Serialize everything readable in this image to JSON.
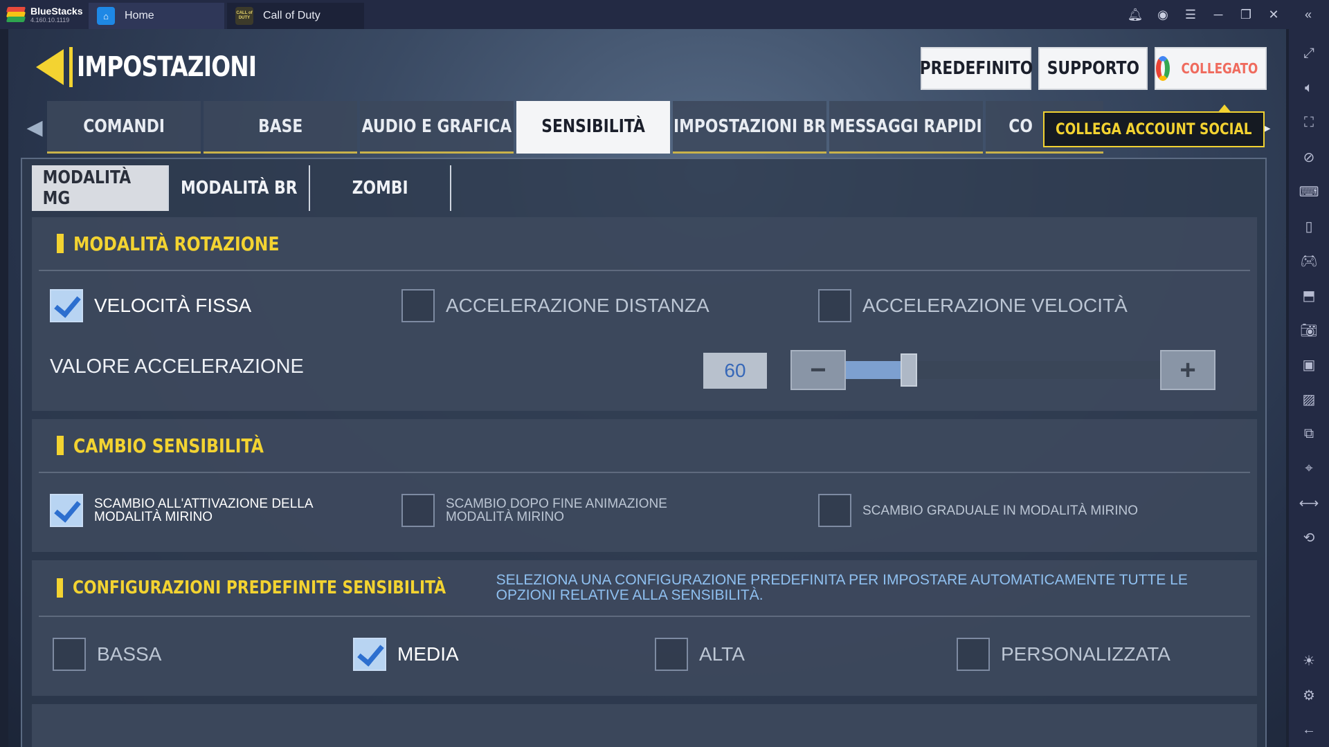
{
  "app": {
    "name": "BlueStacks",
    "version": "4.160.10.1119",
    "tabs": [
      {
        "label": "Home",
        "icon": "home-icon"
      },
      {
        "label": "Call of Duty",
        "icon": "call-of-duty-icon",
        "icon_text": "CALL of DUTY"
      }
    ],
    "window_controls": [
      "bell-icon",
      "account-icon",
      "menu-icon",
      "minimize-icon",
      "restore-icon",
      "close-icon",
      "collapse-sidebar-icon"
    ],
    "sidebar_icons": [
      "fullscreen-icon",
      "mute-icon",
      "screen-select-icon",
      "eye-off-icon",
      "keyboard-icon",
      "phone-icon",
      "gamepad-icon",
      "install-apk-icon",
      "camera-icon",
      "record-icon",
      "media-icon",
      "multi-instance-icon",
      "location-icon",
      "shake-icon",
      "rotate-icon",
      "brightness-icon",
      "settings-icon",
      "back-icon"
    ]
  },
  "game": {
    "title": "IMPOSTAZIONI",
    "top_buttons": {
      "default": "PREDEFINITO",
      "support": "SUPPORTO",
      "linked": "COLLEGATO"
    },
    "main_tabs": [
      "COMANDI",
      "BASE",
      "AUDIO E GRAFICA",
      "SENSIBILITÀ",
      "IMPOSTAZIONI BR",
      "MESSAGGI RAPIDI",
      "CO"
    ],
    "active_main_tab": "SENSIBILITÀ",
    "social_banner": "COLLEGA ACCOUNT SOCIAL",
    "sub_tabs": [
      "MODALITÀ MG",
      "MODALITÀ BR",
      "ZOMBI"
    ],
    "active_sub_tab": "MODALITÀ MG",
    "rotation": {
      "title": "MODALITÀ ROTAZIONE",
      "options": [
        {
          "label": "VELOCITÀ FISSA",
          "checked": true
        },
        {
          "label": "ACCELERAZIONE DISTANZA",
          "checked": false
        },
        {
          "label": "ACCELERAZIONE VELOCITÀ",
          "checked": false
        }
      ],
      "accel_label": "VALORE ACCELERAZIONE",
      "accel_value": "60",
      "slider_fraction": 0.2,
      "minus": "−",
      "plus": "+"
    },
    "sensitivity_change": {
      "title": "CAMBIO SENSIBILITÀ",
      "options": [
        {
          "label": "SCAMBIO ALL'ATTIVAZIONE DELLA MODALITÀ MIRINO",
          "checked": true
        },
        {
          "label": "SCAMBIO DOPO FINE ANIMAZIONE MODALITÀ MIRINO",
          "checked": false
        },
        {
          "label": "SCAMBIO GRADUALE IN MODALITÀ MIRINO",
          "checked": false
        }
      ]
    },
    "presets": {
      "title": "CONFIGURAZIONI PREDEFINITE SENSIBILITÀ",
      "description": "SELEZIONA UNA CONFIGURAZIONE PREDEFINITA PER IMPOSTARE AUTOMATICAMENTE TUTTE LE OPZIONI RELATIVE ALLA SENSIBILITÀ.",
      "options": [
        {
          "label": "BASSA",
          "checked": false
        },
        {
          "label": "MEDIA",
          "checked": true
        },
        {
          "label": "ALTA",
          "checked": false
        },
        {
          "label": "PERSONALIZZATA",
          "checked": false
        }
      ]
    }
  },
  "colors": {
    "accent_yellow": "#f3d331",
    "check_blue": "#2d6fcf",
    "description_blue": "#8fc0f0"
  }
}
